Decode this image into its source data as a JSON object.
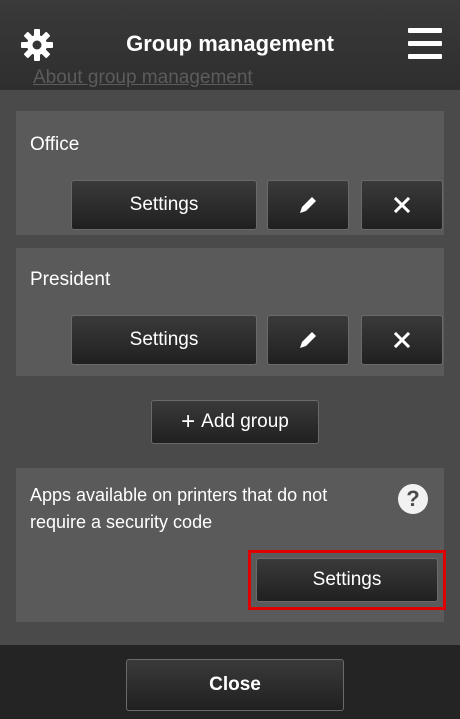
{
  "header": {
    "title": "Group management",
    "settings_icon": "gear-icon",
    "menu_icon": "hamburger-menu-icon"
  },
  "about_link": "About group management",
  "groups": [
    {
      "name": "Office",
      "settings_label": "Settings",
      "edit_icon": "pencil-icon",
      "delete_icon": "close-icon"
    },
    {
      "name": "President",
      "settings_label": "Settings",
      "edit_icon": "pencil-icon",
      "delete_icon": "close-icon"
    }
  ],
  "add_group": {
    "label": "Add group",
    "icon": "plus-icon",
    "symbol": "+"
  },
  "apps_section": {
    "text": "Apps available on printers that do not require a security code",
    "help_symbol": "?",
    "settings_label": "Settings",
    "highlight_color": "#e00000"
  },
  "footer": {
    "close_label": "Close"
  }
}
